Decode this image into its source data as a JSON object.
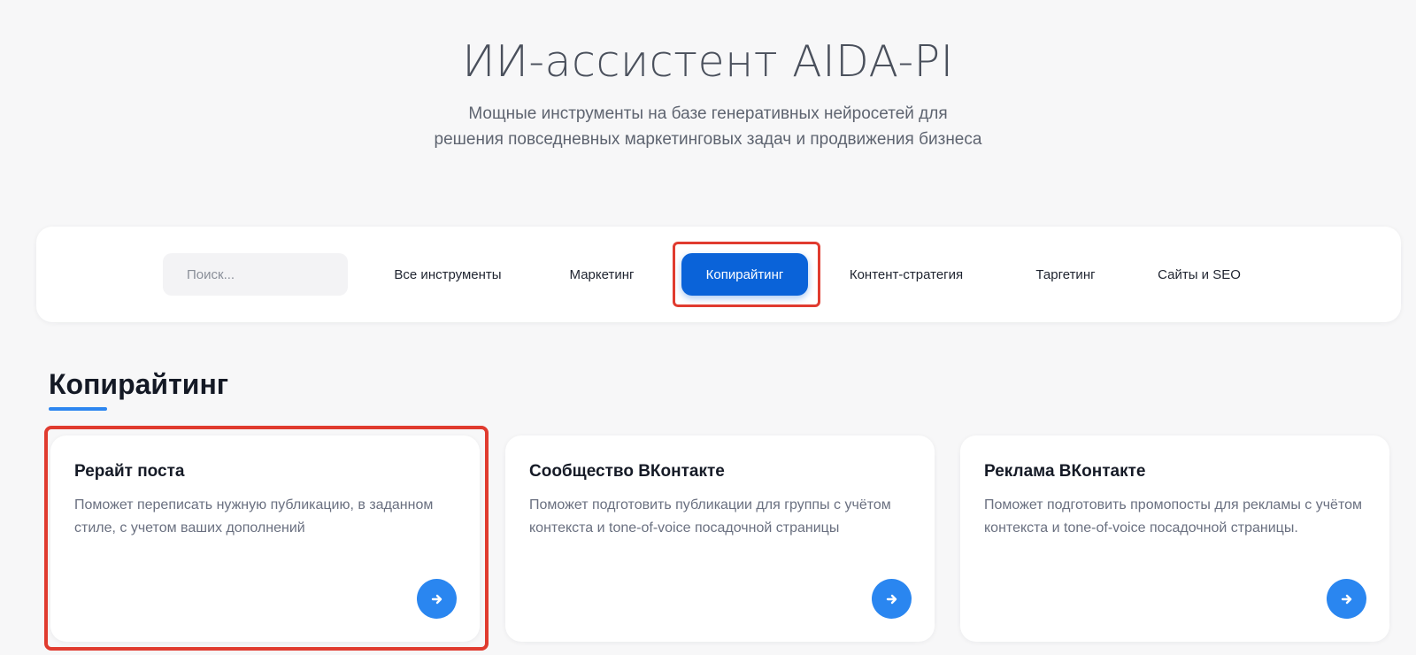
{
  "hero": {
    "title": "ИИ-ассистент AIDA-PI",
    "subtitle_line1": "Мощные инструменты на базе генеративных нейросетей для",
    "subtitle_line2": "решения повседневных маркетинговых задач и продвижения бизнеса"
  },
  "filters": {
    "search_placeholder": "Поиск...",
    "search_value": "",
    "active_tab": "Копирайтинг",
    "tabs": [
      {
        "label": "Все инструменты"
      },
      {
        "label": "Маркетинг"
      },
      {
        "label": "Копирайтинг"
      },
      {
        "label": "Контент-стратегия"
      },
      {
        "label": "Таргетинг"
      },
      {
        "label": "Сайты и SEO"
      }
    ]
  },
  "section": {
    "title": "Копирайтинг"
  },
  "cards": [
    {
      "title": "Рерайт поста",
      "description": "Поможет переписать нужную публикацию, в заданном стиле, с учетом ваших дополнений",
      "action_icon": "arrow-right-icon"
    },
    {
      "title": "Сообщество ВКонтакте",
      "description": "Поможет подготовить публикации для группы с учётом контекста и tone-of-voice посадочной страницы",
      "action_icon": "arrow-right-icon"
    },
    {
      "title": "Реклама ВКонтакте",
      "description": "Поможет подготовить промопосты для рекламы с учётом контекста и tone-of-voice посадочной страницы.",
      "action_icon": "arrow-right-icon"
    }
  ],
  "colors": {
    "accent": "#0a63d9",
    "arrow_button": "#2a86f0",
    "highlight_outline": "#e03b2f",
    "background": "#f7f7f8"
  }
}
